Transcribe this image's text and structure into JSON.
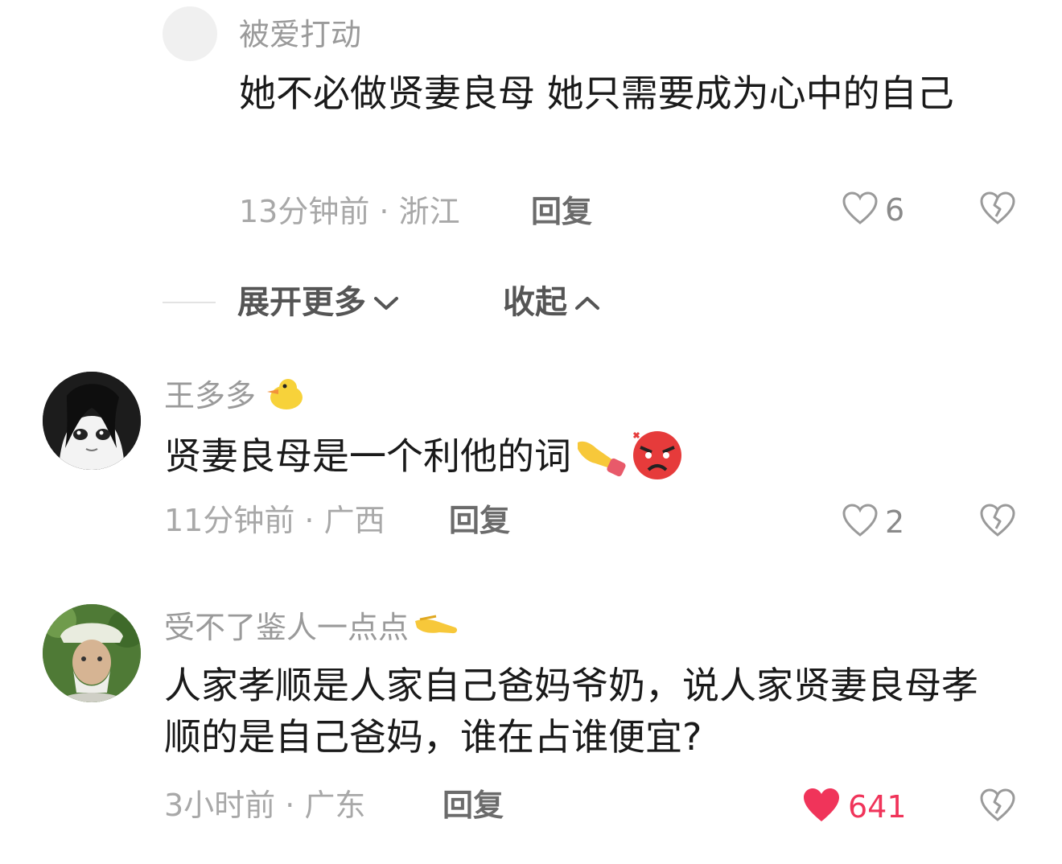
{
  "comments": [
    {
      "username": "被爱打动",
      "text": "她不必做贤妻良母 她只需要成为心中的自己",
      "time_location": "13分钟前 · 浙江",
      "reply_label": "回复",
      "likes": "6",
      "liked": false
    },
    {
      "username": "王多多",
      "text": "贤妻良母是一个利他的词",
      "time_location": "11分钟前 · 广西",
      "reply_label": "回复",
      "likes": "2",
      "liked": false
    },
    {
      "username": "受不了鉴人一点点",
      "text": "人家孝顺是人家自己爸妈爷奶，说人家贤妻良母孝顺的是自己爸妈，谁在占谁便宜?",
      "time_location": "3小时前 · 广东",
      "reply_label": "回复",
      "likes": "641",
      "liked": true
    }
  ],
  "thread_controls": {
    "expand_label": "展开更多",
    "collapse_label": "收起"
  },
  "colors": {
    "like_active": "#f0345a",
    "muted_text": "#9a9a9a"
  },
  "icons": {
    "like": "heart-outline-icon",
    "liked": "heart-filled-icon",
    "dislike": "broken-heart-icon",
    "expand": "chevron-down-icon",
    "collapse": "chevron-up-icon"
  }
}
